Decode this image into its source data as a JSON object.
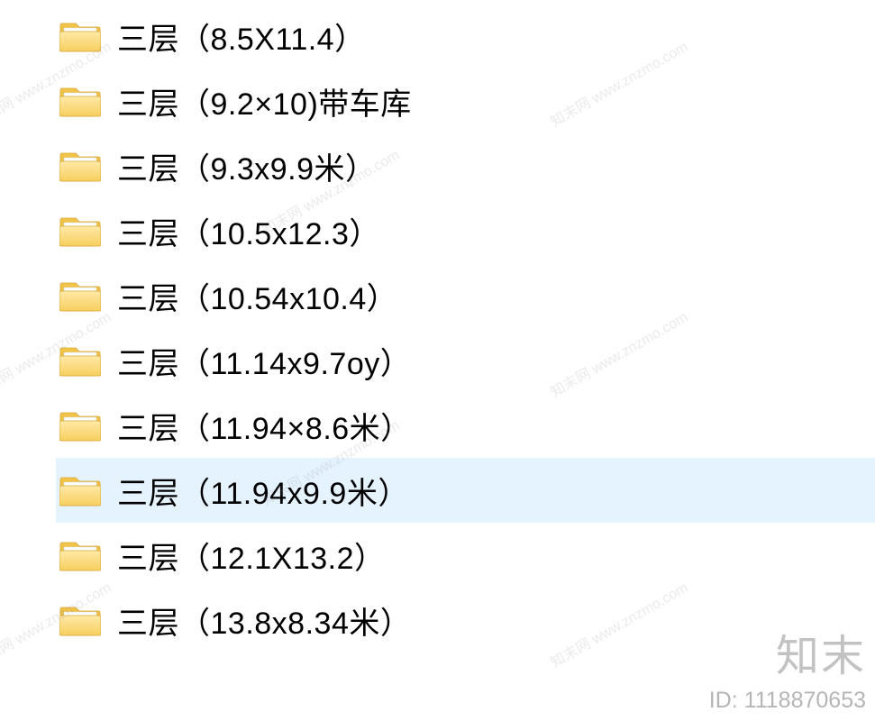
{
  "folders": [
    {
      "name": "三层（8.5X11.4）",
      "selected": false
    },
    {
      "name": "三层（9.2×10)带车库",
      "selected": false
    },
    {
      "name": "三层（9.3x9.9米）",
      "selected": false
    },
    {
      "name": "三层（10.5x12.3）",
      "selected": false
    },
    {
      "name": "三层（10.54x10.4）",
      "selected": false
    },
    {
      "name": "三层（11.14x9.7oy）",
      "selected": false
    },
    {
      "name": "三层（11.94×8.6米）",
      "selected": false
    },
    {
      "name": "三层（11.94x9.9米）",
      "selected": true
    },
    {
      "name": "三层（12.1X13.2）",
      "selected": false
    },
    {
      "name": "三层（13.8x8.34米）",
      "selected": false
    }
  ],
  "watermark": {
    "brand": "知末",
    "id_label": "ID: 1118870653",
    "diag_text": "知末网 www.znzmo.com"
  }
}
